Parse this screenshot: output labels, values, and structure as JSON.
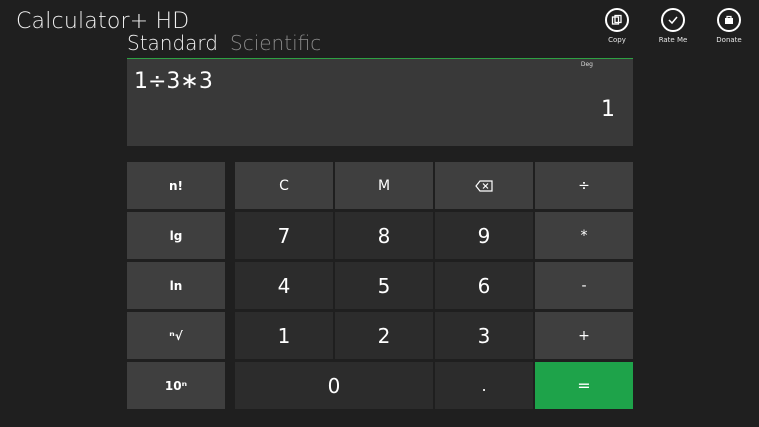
{
  "app": {
    "title": "Calculator+ HD"
  },
  "tabs": [
    {
      "label": "Standard"
    },
    {
      "label": "Scientific"
    }
  ],
  "appbar": {
    "copy": "Copy",
    "rate": "Rate Me",
    "donate": "Donate"
  },
  "display": {
    "expression": "1÷3∗3",
    "angle_mode": "Deg",
    "result": "1"
  },
  "left_keys": [
    "n!",
    "lg",
    "ln",
    "ⁿ√",
    "10ⁿ"
  ],
  "keys": {
    "clear": "C",
    "memory": "M",
    "divide": "÷",
    "seven": "7",
    "eight": "8",
    "nine": "9",
    "multiply": "*",
    "four": "4",
    "five": "5",
    "six": "6",
    "minus": "-",
    "one": "1",
    "two": "2",
    "three": "3",
    "plus": "+",
    "zero": "0",
    "dot": ".",
    "equals": "="
  },
  "colors": {
    "accent": "#1ea34a",
    "background": "#1f1f1f"
  },
  "icons": {
    "backspace": "backspace-icon",
    "copy": "copy-icon",
    "rate": "check-icon",
    "donate": "bag-icon"
  }
}
